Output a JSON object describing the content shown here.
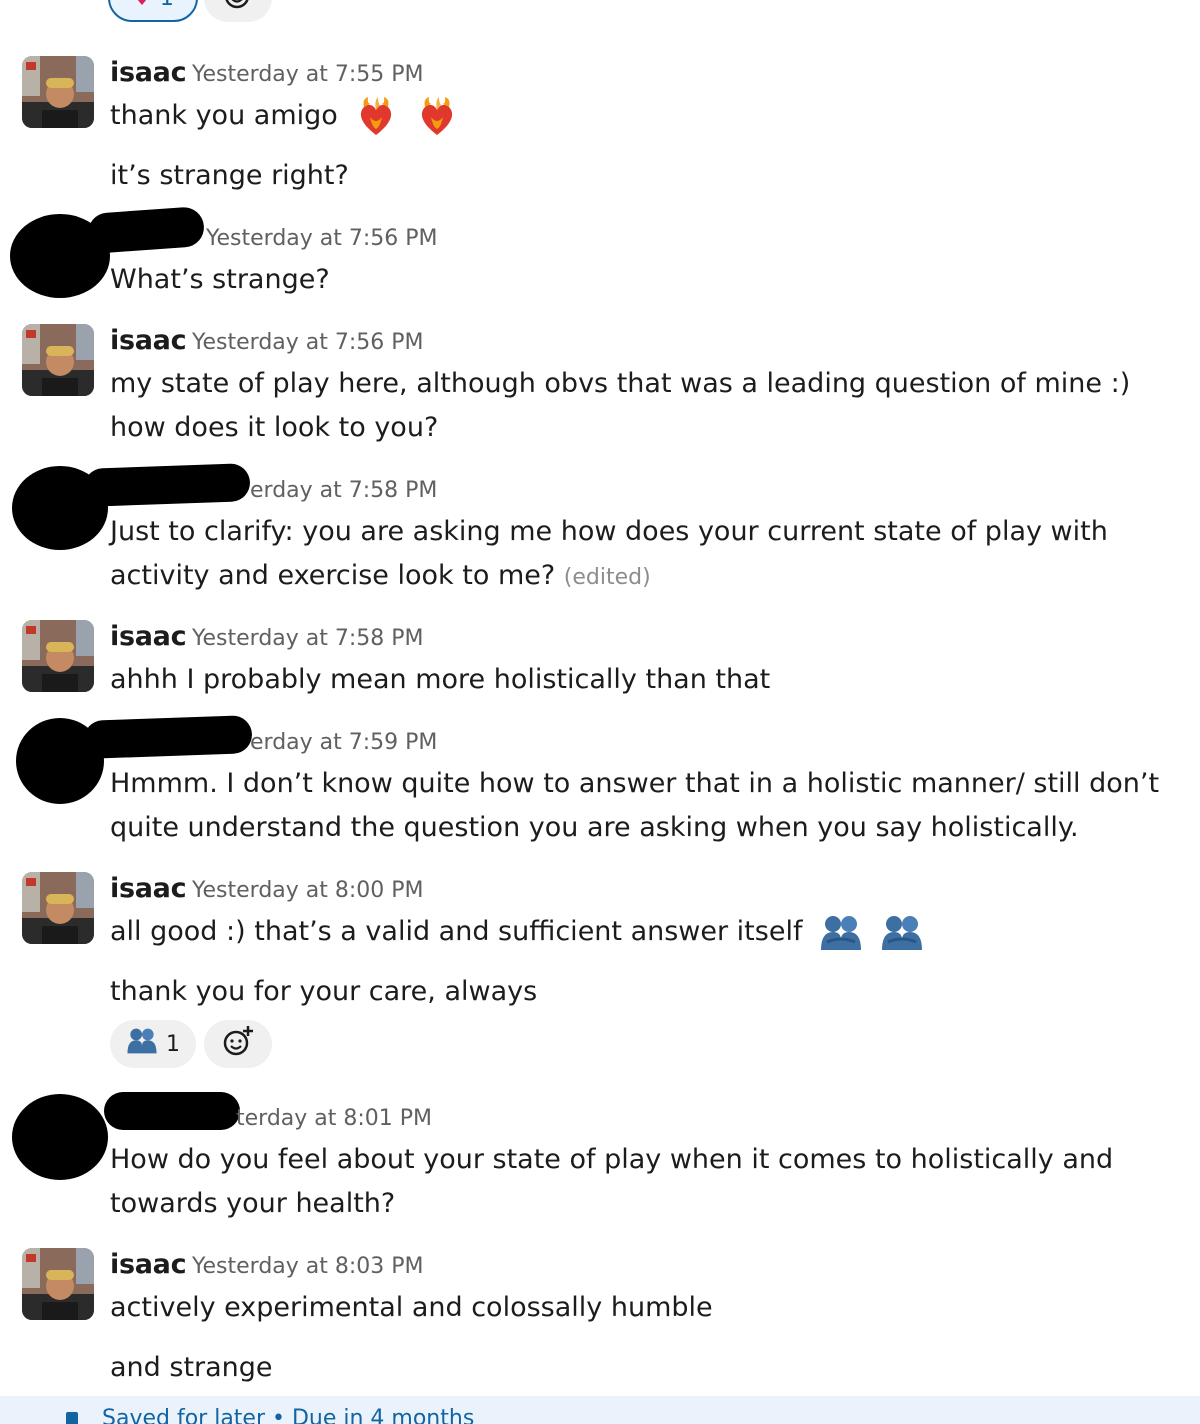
{
  "top_reactions": {
    "heart_count": "1"
  },
  "messages": [
    {
      "author": "isaac",
      "time": "Yesterday at 7:55 PM",
      "lines": [
        "thank you amigo",
        "it’s strange right?"
      ]
    },
    {
      "author": "",
      "time": "Yesterday at 7:56 PM",
      "lines": [
        "What’s strange?"
      ]
    },
    {
      "author": "isaac",
      "time": "Yesterday at 7:56 PM",
      "lines": [
        "my state of play here, although obvs that was a leading question of mine :) how does it look to you?"
      ]
    },
    {
      "author": "",
      "time": "erday at 7:58 PM",
      "lines": [
        "Just to clarify: you are asking me how does your current state of play with activity and exercise look to me?"
      ],
      "edited": "(edited)"
    },
    {
      "author": "isaac",
      "time": "Yesterday at 7:58 PM",
      "lines": [
        "ahhh I probably mean more holistically than that"
      ]
    },
    {
      "author": "",
      "time": "erday at 7:59 PM",
      "lines": [
        "Hmmm. I don’t know quite how to answer that in a holistic manner/ still don’t quite understand the question you are asking when you say holistically."
      ]
    },
    {
      "author": "isaac",
      "time": "Yesterday at 8:00 PM",
      "lines": [
        "all good :) that’s a valid and sufficient answer itself",
        "thank you for your care, always"
      ],
      "reaction_count": "1"
    },
    {
      "author": "",
      "time": "terday at 8:01 PM",
      "lines": [
        "How do you feel about your state of play when it comes to holistically and towards your health?"
      ]
    },
    {
      "author": "isaac",
      "time": "Yesterday at 8:03 PM",
      "lines": [
        "actively experimental and colossally humble",
        "and strange"
      ]
    }
  ],
  "footer": {
    "text": "Saved for later • Due in 4 months"
  },
  "icons": {
    "hug": "hugging-people-icon",
    "fire_heart": "heart-on-fire-icon",
    "add_reaction": "add-reaction-icon",
    "bookmark": "bookmark-icon"
  },
  "colors": {
    "link": "#1264a3",
    "timestamp": "#616061",
    "text": "#1d1c1d",
    "reaction_bg": "#f0f0f0",
    "footer_bg": "#eaf3fb"
  }
}
